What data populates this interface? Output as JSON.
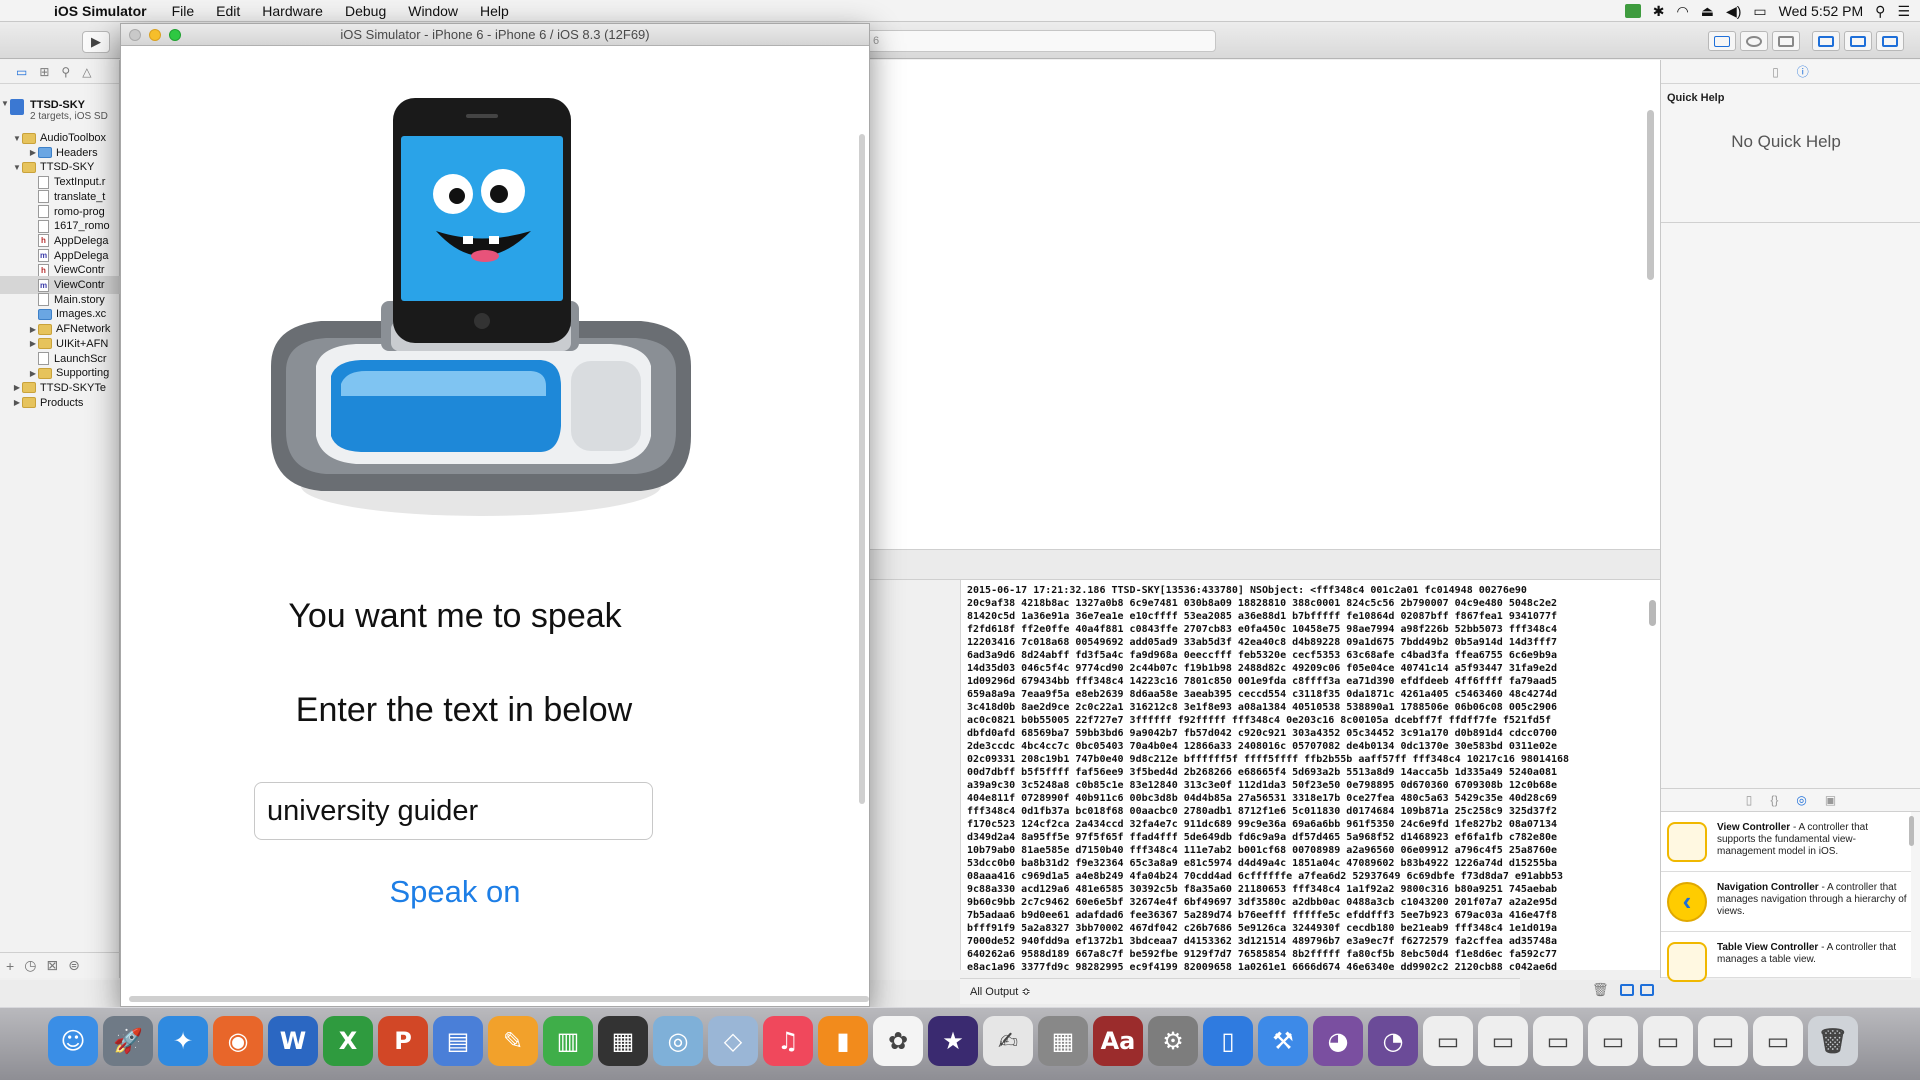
{
  "menubar": {
    "app_name": "iOS Simulator",
    "items": [
      "File",
      "Edit",
      "Hardware",
      "Debug",
      "Window",
      "Help"
    ],
    "clock": "Wed 5:52 PM"
  },
  "xcode": {
    "scheme_text": "6",
    "navigator": {
      "project_name": "TTSD-SKY",
      "project_sub": "2 targets, iOS SD",
      "rows": [
        {
          "label": "AudioToolbox",
          "indent": 1,
          "kind": "folder",
          "tri": "▼"
        },
        {
          "label": "Headers",
          "indent": 2,
          "kind": "folder-blue",
          "tri": "▶"
        },
        {
          "label": "TTSD-SKY",
          "indent": 1,
          "kind": "folder",
          "tri": "▼"
        },
        {
          "label": "TextInput.r",
          "indent": 2,
          "kind": "file",
          "tri": ""
        },
        {
          "label": "translate_t",
          "indent": 2,
          "kind": "file",
          "tri": ""
        },
        {
          "label": "romo-prog",
          "indent": 2,
          "kind": "file",
          "tri": ""
        },
        {
          "label": "1617_romo",
          "indent": 2,
          "kind": "file",
          "tri": ""
        },
        {
          "label": "AppDelega",
          "indent": 2,
          "kind": "file-h",
          "tri": ""
        },
        {
          "label": "AppDelega",
          "indent": 2,
          "kind": "file-m",
          "tri": ""
        },
        {
          "label": "ViewContr",
          "indent": 2,
          "kind": "file-h",
          "tri": ""
        },
        {
          "label": "ViewContr",
          "indent": 2,
          "kind": "file-m",
          "tri": "",
          "selected": true
        },
        {
          "label": "Main.story",
          "indent": 2,
          "kind": "file",
          "tri": ""
        },
        {
          "label": "Images.xc",
          "indent": 2,
          "kind": "folder-blue",
          "tri": ""
        },
        {
          "label": "AFNetwork",
          "indent": 2,
          "kind": "folder",
          "tri": "▶"
        },
        {
          "label": "UIKit+AFN",
          "indent": 2,
          "kind": "folder",
          "tri": "▶"
        },
        {
          "label": "LaunchScr",
          "indent": 2,
          "kind": "file",
          "tri": ""
        },
        {
          "label": "Supporting",
          "indent": 2,
          "kind": "folder",
          "tri": "▶"
        },
        {
          "label": "TTSD-SKYTe",
          "indent": 1,
          "kind": "folder",
          "tri": "▶"
        },
        {
          "label": "Products",
          "indent": 1,
          "kind": "folder",
          "tri": "▶"
        }
      ]
    },
    "console": {
      "filter_label": "All Output ≎",
      "lines": [
        "2015-06-17 17:21:32.186 TTSD-SKY[13536:433780] NSObject: <fff348c4 001c2a01 fc014948 00276e90",
        "20c9af38 4218b8ac 1327a0b8 6c9e7481 030b8a09 18828810 388c0001 824c5c56 2b790007 04c9e480 5048c2e2",
        "81420c5d 1a36e91a 36e7ea1e e10cffff 53ea2085 a36e88d1 b7bfffff fe10864d 02087bff f867fea1 9341077f",
        "f2fd618f ff2e0ffe 40a4f881 c0843ffe 2707cb83 e0fa450c 10458e75 98ae7994 a98f226b 52bb5073 fff348c4",
        "12203416 7c018a68 00549692 add05ad9 33ab5d3f 42ea40c8 d4b89228 09a1d675 7bdd49b2 0b5a914d 14d3fff7",
        "6ad3a9d6 8d24abff fd3f5a4c fa9d968a 0eeccfff feb5320e cecf5353 63c68afe c4bad3fa ffea6755 6c6e9b9a",
        "14d35d03 046c5f4c 9774cd90 2c44b07c f19b1b98 2488d82c 49209c06 f05e04ce 40741c14 a5f93447 31fa9e2d",
        "1d09296d 679434bb fff348c4 14223c16 7801c850 001e9fda c8ffff3a ea71d390 efdfdeeb 4ff6ffff fa79aad5",
        "659a8a9a 7eaa9f5a e8eb2639 8d6aa58e 3aeab395 ceccd554 c3118f35 0da1871c 4261a405 c5463460 48c4274d",
        "3c418d0b 8ae2d9ce 2c0c22a1 316212c8 3e1f8e93 a08a1384 40510538 538890a1 1788506e 06b06c08 005c2906",
        "ac0c0821 b0b55005 22f727e7 3ffffff f92fffff fff348c4 0e203c16 8c00105a dcebff7f ffdff7fe f521fd5f",
        "dbfd0afd 68569ba7 59bb3bd6 9a9042b7 fb57d042 c920c921 303a4352 05c34452 3c91a170 d0b891d4 cdcc0700",
        "2de3ccdc 4bc4cc7c 0bc05403 70a4b0e4 12866a33 2408016c 05707082 de4b0134 0dc1370e 30e583bd 0311e02e",
        "02c09331 208c19b1 747b0e40 9d8c212e bffffff5f ffff5ffff ffb2b55b aaff57ff fff348c4 10217c16 98014168",
        "00d7dbff b5f5ffff faf56ee9 3f5bed4d 2b268266 e68665f4 5d693a2b 5513a8d9 14acca5b 1d335a49 5240a081",
        "a39a9c30 3c5248a8 c0b85c1e 83e12840 313c3e0f 112d1da3 50f23e50 0e798895 0d670360 6709308b 12c0b68e",
        "404e811f 0728990f 40b911c6 00bc3d8b 04d4b85a 27a56531 3318e17b 0ce27fea 480c5a63 5429c35e 40d28c69",
        "fff348c4 0d1fb37a bc018f68 00aacbc0 2780adb1 8712f1e6 5c011830 d0174684 109b871a 25c258c9 325d37f2",
        "f170c523 124cf2ca 2a434ccd 32fa4e7c 911dc689 99c9e36a 69a6a6bb 961f5350 24c6e9fd 1fe827b2 08a07134",
        "d349d2a4 8a95ff5e 97f5f65f ffad4fff 5de649db fd6c9a9a df57d465 5a968f52 d1468923 ef6fa1fb c782e80e",
        "10b79ab0 81ae585e d7150b40 fff348c4 111e7ab2 b001cf68 00708989 a2a96560 06e09912 a796c4f5 25a8760e",
        "53dcc0b0 ba8b31d2 f9e32364 65c3a8a9 e81c5974 d4d49a4c 1851a04c 47089602 b83b4922 1226a74d d15255ba",
        "08aaa416 c969d1a5 a4e8b249 4fa04b24 70cdd4ad 6cffffffe a7fea6d2 52937649 6c69dbfe f73d8da7 e91abb53",
        "9c88a330 acd129a6 481e6585 30392c5b f8a35a60 21180653 fff348c4 1a1f92a2 9800c316 b80a9251 745aebab",
        "9b60c9bb 2c7c9462 60e6e5bf 32674e4f 6bf49697 3df3580c a2dbb0ac 0488a3cb c1043200 201f07a7 a2a2e95d",
        "7b5adaa6 b9d0ee61 adafdad6 fee36367 5a289d74 b76eefff fffffe5c efddfff3 5ee7b923 679ac03a 416e47f8",
        "bfff91f9 5a2a8327 3bb70002 467df042 c26b7686 5e9126ca 3244930f cecdb180 be21eab9 fff348c4 1e1d019a",
        "7000de52 940fdd9a ef1372b1 3bdceaa7 d4153362 3d121514 489796b7 e3a9ec7f f6272579 fa2cffea ad35748a",
        "640262a6 9588d189 667a8c7f be592fbe 9129f7d7 76585854 8b2fffff fa80cf5b 8ebc50d4 f1e8d6ec fa592c77",
        "e8ac1a96 3377fd9c 98282995 ec9f4199 82009658 1a0261e1 6666d674 46e6340e dd9902c2 2120cb88 c042ae6d"
      ]
    },
    "inspector": {
      "quick_help_title": "Quick Help",
      "no_quick_help": "No Quick Help",
      "library": [
        {
          "name": "View Controller",
          "desc": " - A controller that supports the fundamental view-management model in iOS."
        },
        {
          "name": "Navigation Controller",
          "desc": " - A controller that manages navigation through a hierarchy of views."
        },
        {
          "name": "Table View Controller",
          "desc": " - A controller that manages a table view."
        }
      ]
    }
  },
  "simulator": {
    "window_title": "iOS Simulator - iPhone 6 - iPhone 6 / iOS 8.3 (12F69)",
    "label_speak": "You want me to speak",
    "label_enter": "Enter the text in below",
    "input_value": "university guider",
    "button_label": "Speak on"
  },
  "dock": {
    "apps": [
      {
        "name": "finder-icon",
        "color": "#3a8ee6",
        "glyph": "☺"
      },
      {
        "name": "launchpad-icon",
        "color": "#6f7a86",
        "glyph": "🚀"
      },
      {
        "name": "safari-icon",
        "color": "#2f8ae0",
        "glyph": "✦"
      },
      {
        "name": "firefox-icon",
        "color": "#e8662a",
        "glyph": "◉"
      },
      {
        "name": "word-icon",
        "color": "#2b67c2",
        "glyph": "W"
      },
      {
        "name": "excel-icon",
        "color": "#2f9b3f",
        "glyph": "X"
      },
      {
        "name": "powerpoint-icon",
        "color": "#d24726",
        "glyph": "P"
      },
      {
        "name": "keynote-icon",
        "color": "#4a7fd8",
        "glyph": "▤"
      },
      {
        "name": "pages-icon",
        "color": "#f2a12b",
        "glyph": "✎"
      },
      {
        "name": "numbers-icon",
        "color": "#3fae49",
        "glyph": "▥"
      },
      {
        "name": "imovie-icon",
        "color": "#333333",
        "glyph": "▦"
      },
      {
        "name": "network-icon",
        "color": "#7fb0d8",
        "glyph": "◎"
      },
      {
        "name": "xcode-box-icon",
        "color": "#9ab6d6",
        "glyph": "◇"
      },
      {
        "name": "itunes-icon",
        "color": "#f0485c",
        "glyph": "♫"
      },
      {
        "name": "ibooks-icon",
        "color": "#f28b1c",
        "glyph": "▮"
      },
      {
        "name": "photos-icon",
        "color": "#f4f4f4",
        "glyph": "✿"
      },
      {
        "name": "imovie-star-icon",
        "color": "#3a2a70",
        "glyph": "★"
      },
      {
        "name": "textedit-icon",
        "color": "#e6e6e6",
        "glyph": "✍"
      },
      {
        "name": "calculator-icon",
        "color": "#888888",
        "glyph": "▦"
      },
      {
        "name": "dictionary-icon",
        "color": "#9b2c2c",
        "glyph": "Aa"
      },
      {
        "name": "system-preferences-icon",
        "color": "#7d7d7d",
        "glyph": "⚙"
      },
      {
        "name": "simulator-icon",
        "color": "#2f7be0",
        "glyph": "▯"
      },
      {
        "name": "xcode-icon",
        "color": "#3d8ae8",
        "glyph": "⚒"
      },
      {
        "name": "github-icon",
        "color": "#7a4fa0",
        "glyph": "◕"
      },
      {
        "name": "github-desktop-icon",
        "color": "#6b4b98",
        "glyph": "◔"
      },
      {
        "name": "window-thumb-1-icon",
        "color": "#eeeeee",
        "glyph": "▭"
      },
      {
        "name": "window-thumb-2-icon",
        "color": "#eeeeee",
        "glyph": "▭"
      },
      {
        "name": "window-thumb-3-icon",
        "color": "#eeeeee",
        "glyph": "▭"
      },
      {
        "name": "window-thumb-4-icon",
        "color": "#eeeeee",
        "glyph": "▭"
      },
      {
        "name": "window-thumb-5-icon",
        "color": "#eeeeee",
        "glyph": "▭"
      },
      {
        "name": "window-thumb-6-icon",
        "color": "#eeeeee",
        "glyph": "▭"
      },
      {
        "name": "window-thumb-7-icon",
        "color": "#eeeeee",
        "glyph": "▭"
      },
      {
        "name": "trash-icon",
        "color": "#cfd3d8",
        "glyph": "🗑"
      }
    ]
  }
}
